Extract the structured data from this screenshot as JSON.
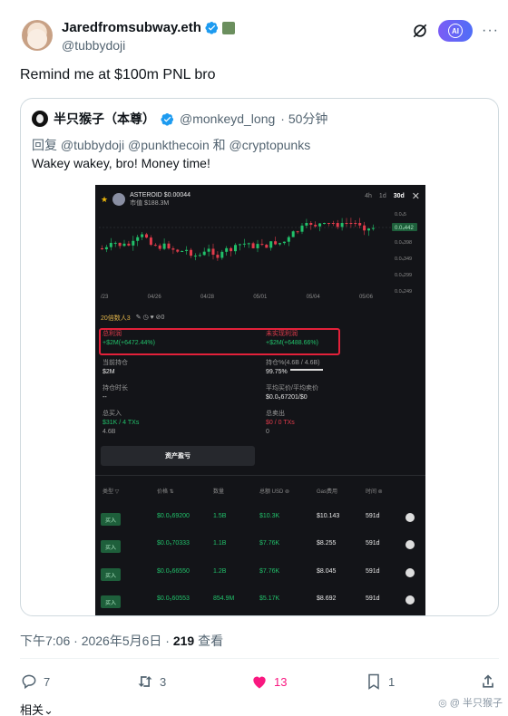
{
  "author": {
    "name": "Jaredfromsubway.eth",
    "handle": "@tubbydoji",
    "verified": true
  },
  "header_actions": {
    "grok_icon": "slash-circle-icon",
    "ai_label": "AI",
    "more": "···"
  },
  "tweet": {
    "text": "Remind me at $100m PNL bro"
  },
  "quote": {
    "name": "半只猴子（本尊）",
    "handle": "@monkeyd_long",
    "time": "· 50分钟",
    "reply_line": "回复 @tubbydoji @punkthecoin 和 @cryptopunks",
    "text": "Wakey wakey, bro! Money time!"
  },
  "screenshot": {
    "token": "ASTEROID $0.00044",
    "mcap": "市值 $188.3M",
    "timeframes": [
      "4h",
      "1d",
      "30d"
    ],
    "active_timeframe": "30d",
    "close": "✕",
    "price_tag": "0.0₄442",
    "y_ticks": [
      "0.0₄5",
      "0.0₄398",
      "0.0₄349",
      "0.0₄299",
      "0.0₄249"
    ],
    "x_ticks": [
      "/23",
      "04/26",
      "04/28",
      "05/01",
      "05/04",
      "05/06"
    ],
    "user_line": "20倍数人3",
    "user_icons": "✎ ◷ ♥ ⊘0",
    "total_profit_label": "总利润",
    "total_profit_value": "+$2M(+6472.44%)",
    "unrealized_label": "未实现利润",
    "unrealized_value": "+$2M(+6488.66%)",
    "holding_label": "当前持仓",
    "holding_value": "$2M",
    "holding_pct_label": "持仓%(4.6B / 4.6B)",
    "holding_pct_value": "99.75%",
    "hold_time_label": "持仓时长",
    "hold_time_value": "--",
    "avg_label": "平均买价/平均卖价",
    "avg_value": "$0.0₅67201/$0",
    "total_buy_label": "总买入",
    "total_buy_value": "$31K / 4 TXs",
    "total_buy_sub": "4.6B",
    "total_sell_label": "总卖出",
    "total_sell_value": "$0 / 0 TXs",
    "total_sell_sub": "0",
    "asset_button": "资产盈亏",
    "table_headers": [
      "类型 ▽",
      "价格 ⇅",
      "数量",
      "总额  USD ⊚",
      "Gas费用",
      "时间 ⊚"
    ],
    "rows": [
      {
        "type": "买入",
        "price": "$0.0₅69200",
        "qty": "1.5B",
        "total": "$10.3K",
        "gas": "$10.143",
        "age": "591d"
      },
      {
        "type": "买入",
        "price": "$0.0₅70333",
        "qty": "1.1B",
        "total": "$7.76K",
        "gas": "$8.255",
        "age": "591d"
      },
      {
        "type": "买入",
        "price": "$0.0₅66550",
        "qty": "1.2B",
        "total": "$7.76K",
        "gas": "$8.045",
        "age": "591d"
      },
      {
        "type": "买入",
        "price": "$0.0₅60553",
        "qty": "854.9M",
        "total": "$5.17K",
        "gas": "$8.692",
        "age": "591d"
      }
    ],
    "colors": {
      "up": "#21c06a",
      "down": "#e23b4b",
      "highlight": "#e3213a"
    }
  },
  "meta": {
    "time": "下午7:06 · 2026年5月6日 · ",
    "views": "219",
    "views_label": " 查看"
  },
  "actions": {
    "replies": "7",
    "reposts": "3",
    "likes": "13",
    "bookmarks": "1"
  },
  "related": "相关⌄",
  "watermark": "◎ @ 半只猴子"
}
